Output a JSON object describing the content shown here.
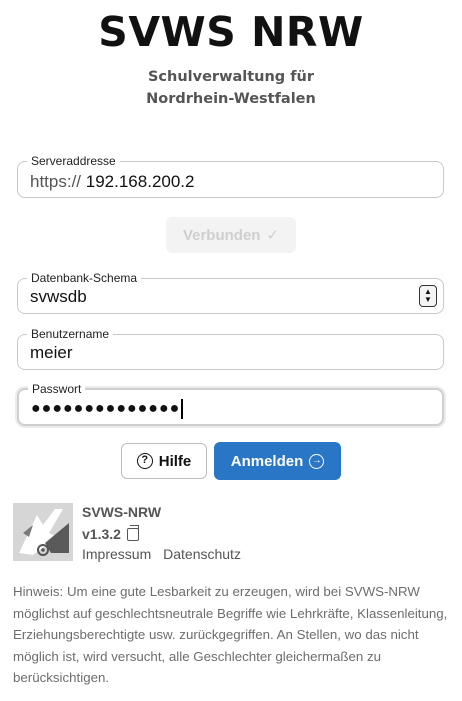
{
  "header": {
    "title": "SVWS NRW",
    "subtitle_line1": "Schulverwaltung für",
    "subtitle_line2": "Nordrhein-Westfalen"
  },
  "server": {
    "label": "Serveraddresse",
    "prefix": "https://",
    "value": "192.168.200.2"
  },
  "connect_button": {
    "label": "Verbunden",
    "icon": "check-icon"
  },
  "schema": {
    "label": "Datenbank-Schema",
    "value": "svwsdb",
    "icon": "spinner-updown-icon"
  },
  "username": {
    "label": "Benutzername",
    "value": "meier"
  },
  "password": {
    "label": "Passwort",
    "value": "●●●●●●●●●●●●●●"
  },
  "actions": {
    "help_label": "Hilfe",
    "help_icon": "question-circle-icon",
    "login_label": "Anmelden",
    "login_icon": "login-arrow-circle-icon",
    "login_color": "#2a76c6"
  },
  "footer": {
    "app_name": "SVWS-NRW",
    "version": "v1.3.2",
    "version_icon": "copy-icon",
    "link_impressum": "Impressum",
    "link_datenschutz": "Datenschutz",
    "hint": "Hinweis: Um eine gute Lesbarkeit zu erzeugen, wird bei SVWS-NRW möglichst auf geschlechtsneutrale Begriffe wie Lehrkräfte, Klassenleitung, Erziehungsberechtigte usw. zurückgegriffen. An Stellen, wo das nicht möglich ist, wird versucht, alle Geschlechter gleichermaßen zu berücksichtigen."
  }
}
